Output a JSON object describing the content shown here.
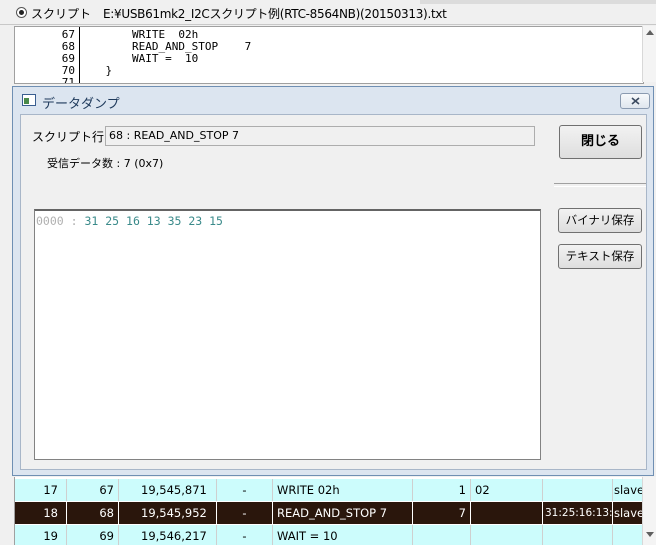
{
  "top": {
    "radio_label": "スクリプト",
    "script_path": "E:¥USB61mk2_I2Cスクリプト例(RTC-8564NB)(20150313).txt"
  },
  "code_lines": [
    {
      "num": "67",
      "text": "        WRITE  02h"
    },
    {
      "num": "68",
      "text": "        READ_AND_STOP    7"
    },
    {
      "num": "69",
      "text": "        WAIT =  10"
    },
    {
      "num": "70",
      "text": "    }"
    },
    {
      "num": "71",
      "text": ""
    }
  ],
  "dialog": {
    "title": "データダンプ",
    "script_line_label": "スクリプト行",
    "script_line_value": "68 : READ_AND_STOP   7",
    "received_count": "受信データ数 : 7 (0x7)",
    "dump_address": "0000 :",
    "dump_bytes": "31 25 16 13 35 23 15",
    "close_button": "閉じる",
    "binary_save_button": "バイナリ保存",
    "text_save_button": "テキスト保存"
  },
  "table_rows": [
    {
      "cells": [
        "17",
        "67",
        "19,545,871",
        "-",
        "WRITE  02h",
        "1",
        "02",
        "",
        "slave"
      ],
      "selected": false
    },
    {
      "cells": [
        "18",
        "68",
        "19,545,952",
        "-",
        "READ_AND_STOP    7",
        "7",
        "",
        "31:25:16:13:...",
        "slave"
      ],
      "selected": true
    },
    {
      "cells": [
        "19",
        "69",
        "19,546,217",
        "-",
        "WAIT =  10",
        "",
        "",
        "",
        ""
      ],
      "selected": false
    }
  ],
  "colors": {
    "row_background": "#ccfcfc",
    "selected_row_background": "#2a160c",
    "dump_byte_color": "#3a8a8a",
    "dialog_frame": "#dce5f0"
  }
}
